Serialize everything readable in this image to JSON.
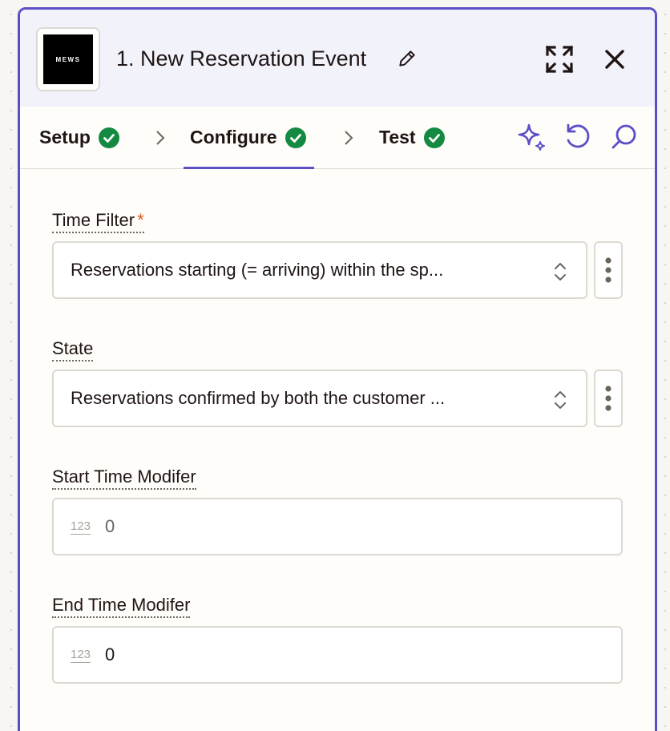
{
  "header": {
    "logo_text": "MEWS",
    "title": "1. New Reservation Event"
  },
  "tabs": [
    {
      "label": "Setup",
      "complete": true
    },
    {
      "label": "Configure",
      "complete": true,
      "active": true
    },
    {
      "label": "Test",
      "complete": true
    }
  ],
  "fields": {
    "time_filter": {
      "label": "Time Filter",
      "required_mark": "*",
      "value": "Reservations starting (= arriving) within the sp..."
    },
    "state": {
      "label": "State",
      "value": "Reservations confirmed by both the customer ..."
    },
    "start_time_modifier": {
      "label": "Start Time Modifer",
      "type_badge": "123",
      "value": "0"
    },
    "end_time_modifier": {
      "label": "End Time Modifer",
      "type_badge": "123",
      "value": "0"
    }
  },
  "colors": {
    "accent": "#5b4fc7",
    "success": "#138942",
    "required": "#e85a1c"
  }
}
